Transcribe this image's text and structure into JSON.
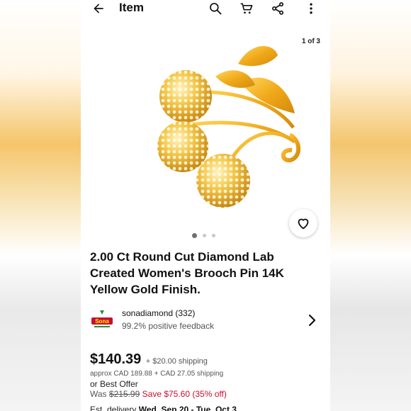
{
  "header": {
    "title": "Item",
    "icons": [
      "arrow-back-icon",
      "search-icon",
      "cart-icon",
      "share-icon",
      "more-vert-icon"
    ]
  },
  "gallery": {
    "counter": "1 of 3",
    "dots": 3,
    "active_dot": 0
  },
  "product": {
    "title": "2.00 Ct Round Cut Diamond Lab Created Women's Brooch Pin 14K Yellow Gold Finish."
  },
  "seller": {
    "name": "sonadiamond (332)",
    "feedback": "99.2% positive feedback",
    "logo_text": "Sona"
  },
  "pricing": {
    "price": "$140.39",
    "shipping": "+ $20.00 shipping",
    "approx": "approx CAD 189.88 + CAD 27.05 shipping",
    "best_offer": "or Best Offer",
    "was_label": "Was",
    "was_price": "$215.99",
    "save": "Save $75.60 (35% off)"
  },
  "delivery": {
    "label": "Est. delivery",
    "dates": "Wed, Sep 20 - Tue, Oct 3"
  },
  "colors": {
    "accent_red": "#c8102e",
    "text": "#111111",
    "gold": "#f2b01e"
  }
}
